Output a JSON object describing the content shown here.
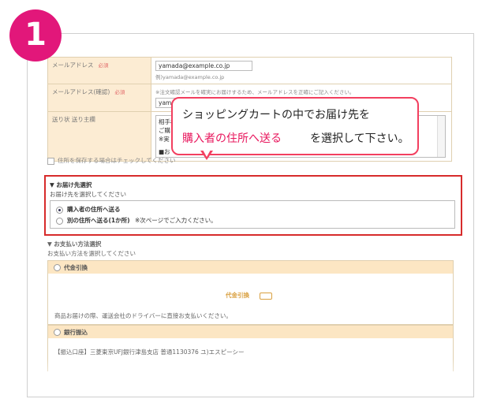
{
  "step": {
    "number": "1"
  },
  "form": {
    "email": {
      "label": "メールアドレス",
      "required": "必須",
      "value": "yamada@example.co.jp",
      "hint": "例)yamada@example.co.jp"
    },
    "email_confirm": {
      "label": "メールアドレス(確認)",
      "required": "必須",
      "note": "※注文確認メールを確実にお届けするため、メールアドレスを正確にご記入ください。",
      "value_partial": "yama"
    },
    "message": {
      "label": "送り状 送り主欄",
      "lines": [
        "相手様",
        "ご購",
        "※実"
      ],
      "line4": "■お"
    },
    "save_checkbox_label": "住所を保存する場合はチェックしてください"
  },
  "callout": {
    "line1": "ショッピングカートの中でお届け先を",
    "highlight": "購入者の住所へ送る",
    "line2_rest": "を選択して下さい。"
  },
  "delivery": {
    "title": "▼ お届け先選択",
    "subtitle": "お届け先を選択してください",
    "options": [
      {
        "label": "購入者の住所へ送る",
        "selected": true
      },
      {
        "label": "別の住所へ送る(1か所)",
        "note": "※次ページでご入力ください。",
        "selected": false
      }
    ]
  },
  "payment": {
    "title": "▼ お支払い方法選択",
    "subtitle": "お支払い方法を選択してください",
    "methods": [
      {
        "name": "代金引換",
        "banner": "代金引換",
        "note": "商品お届けの際、運送会社のドライバーに直接お支払いください。"
      },
      {
        "name": "銀行振込",
        "note": "【振込口座】三菱東京UFJ銀行津島支店 普通1130376 ユ)エスピーシー"
      }
    ]
  },
  "colors": {
    "badge": "#e2177a",
    "callout_border": "#f23f5f",
    "highlight": "#e8175d",
    "delivery_border": "#d72b2b",
    "label_bg": "#fcecd3"
  }
}
